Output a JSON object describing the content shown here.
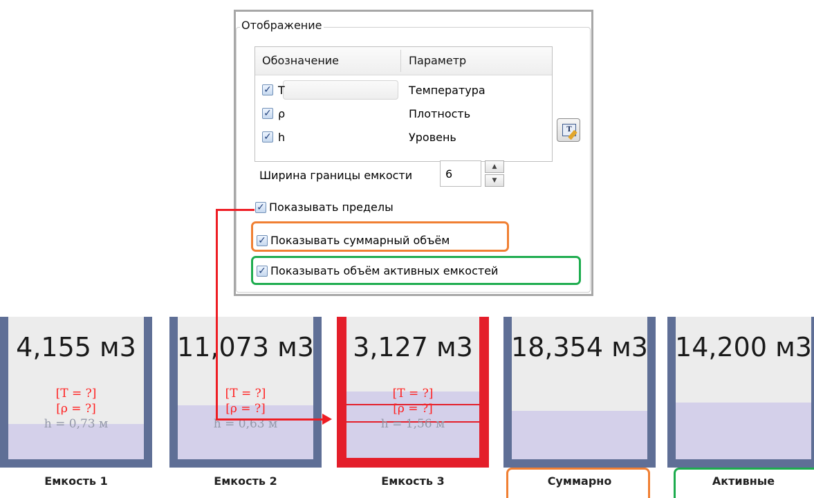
{
  "panel": {
    "group_title": "Отображение",
    "columns": [
      "Обозначение",
      "Параметр"
    ],
    "rows": [
      {
        "symbol": "T",
        "param": "Температура",
        "checked": true
      },
      {
        "symbol": "ρ",
        "param": "Плотность",
        "checked": true
      },
      {
        "symbol": "h",
        "param": "Уровень",
        "checked": true
      }
    ],
    "check_mark": "✓",
    "font_button_icon": "font-edit-icon",
    "width_label": "Ширина границы емкости",
    "width_value": "6",
    "options": {
      "show_limits": "Показывать пределы",
      "show_total": "Показывать суммарный объём",
      "show_active": "Показывать объём активных емкостей"
    },
    "highlight_colors": {
      "total": "#f07f32",
      "active": "#1dac4e",
      "limits_arrow": "#ee1d24"
    }
  },
  "tanks": [
    {
      "volume": "4,155 м3",
      "t": "[T = ?]",
      "p": "[ρ = ?]",
      "h": "h = 0,73 м",
      "label": "Емкость 1",
      "fill_fraction": 0.25
    },
    {
      "volume": "11,073 м3",
      "t": "[T = ?]",
      "p": "[ρ = ?]",
      "h": "h = 0,63 м",
      "label": "Емкость 2",
      "fill_fraction": 0.38
    },
    {
      "volume": "3,127 м3",
      "t": "[T = ?]",
      "p": "[ρ = ?]",
      "h": "h = 1,56 м",
      "label": "Емкость 3",
      "fill_fraction": 0.47
    },
    {
      "volume": "18,354 м3",
      "label": "Суммарно",
      "fill_fraction": 0.34
    },
    {
      "volume": "14,200 м3",
      "label": "Активные",
      "fill_fraction": 0.4
    }
  ],
  "colors": {
    "tank_border": "#5f6f96",
    "tank_fill": "#d4d0ea",
    "tank_bg": "#ececec",
    "selected_border": "#e41e2a",
    "unknown_text": "#ff2020"
  }
}
